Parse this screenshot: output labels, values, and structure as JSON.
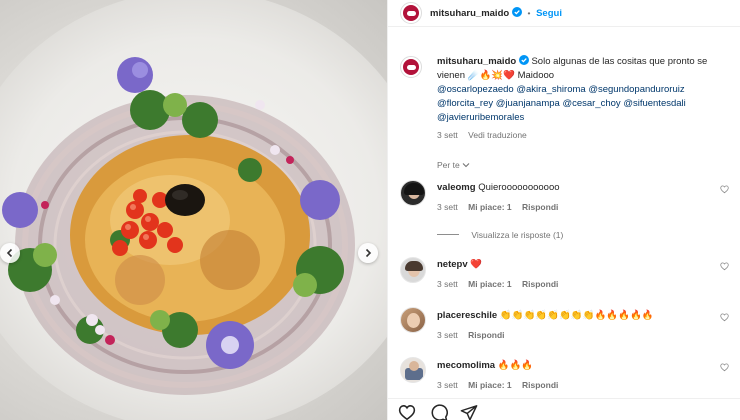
{
  "post_header": {
    "username": "mitsuharu_maido",
    "separator": "•",
    "follow_label": "Segui"
  },
  "caption": {
    "username": "mitsuharu_maido",
    "text_1": "Solo algunas de las cositas que pronto se",
    "text_2": "vienen",
    "emoji": "☄️🔥💥❤️",
    "text_3": "Maidooo",
    "tags": [
      "@oscarlopezaedo",
      "@akira_shiroma",
      "@segundopanduroruiz",
      "@florcita_rey",
      "@juanjanampa",
      "@cesar_choy",
      "@sifuentesdali",
      "@javieruribemorales"
    ],
    "time": "3 sett",
    "translate": "Vedi traduzione"
  },
  "sort_label": "Per te",
  "comments": [
    {
      "username": "valeomg",
      "text": "Quierooooooooooo",
      "time": "3 sett",
      "likes": "Mi piace: 1",
      "reply": "Rispondi",
      "view_replies": "Visualizza le risposte (1)"
    },
    {
      "username": "netepv",
      "text": "❤️",
      "time": "3 sett",
      "likes": "Mi piace: 1",
      "reply": "Rispondi"
    },
    {
      "username": "placereschile",
      "text": "👏👏👏👏👏👏👏👏🔥🔥🔥🔥🔥",
      "time": "3 sett",
      "reply": "Rispondi"
    },
    {
      "username": "mecomolima",
      "text": "🔥🔥🔥",
      "time": "3 sett",
      "likes": "Mi piace: 1",
      "reply": "Rispondi"
    }
  ],
  "icons": {
    "verified": "verified-badge-icon",
    "more": "more-horizontal-icon",
    "like": "heart-icon",
    "comment": "comment-icon",
    "share": "paper-plane-icon",
    "prev": "chevron-left-icon",
    "next": "chevron-right-icon"
  },
  "colors": {
    "accent": "#0095f6",
    "link": "#00376b",
    "brand": "#b2123a",
    "muted": "#737373"
  }
}
